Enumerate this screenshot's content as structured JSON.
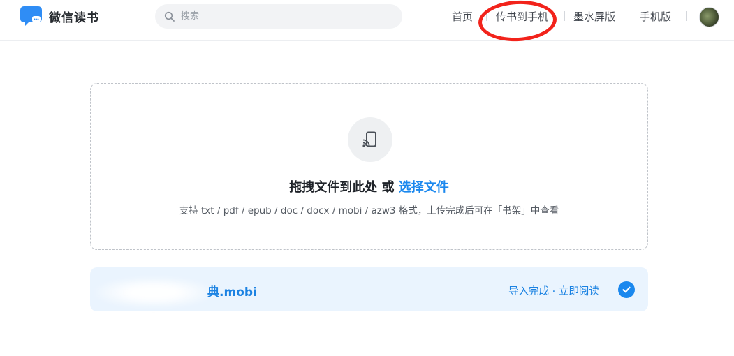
{
  "app": {
    "name": "微信读书"
  },
  "search": {
    "placeholder": "搜索"
  },
  "nav": {
    "items": [
      {
        "label": "首页"
      },
      {
        "label": "传书到手机"
      },
      {
        "label": "墨水屏版"
      },
      {
        "label": "手机版"
      }
    ]
  },
  "upload": {
    "title": "拖拽文件到此处 或 ",
    "pick_label": "选择文件",
    "hint": "支持 txt / pdf / epub / doc / docx / mobi / azw3 格式，上传完成后可在「书架」中查看"
  },
  "file": {
    "name": "典.mobi",
    "status": "导入完成 · 立即阅读"
  },
  "colors": {
    "accent": "#1b88ee",
    "annotation": "#f2231b",
    "file_row_bg": "#eaf4fe"
  },
  "icons": {
    "logo": "weread-logo-icon",
    "search": "search-icon",
    "upload": "cast-to-phone-icon",
    "status": "checkmark-icon"
  }
}
